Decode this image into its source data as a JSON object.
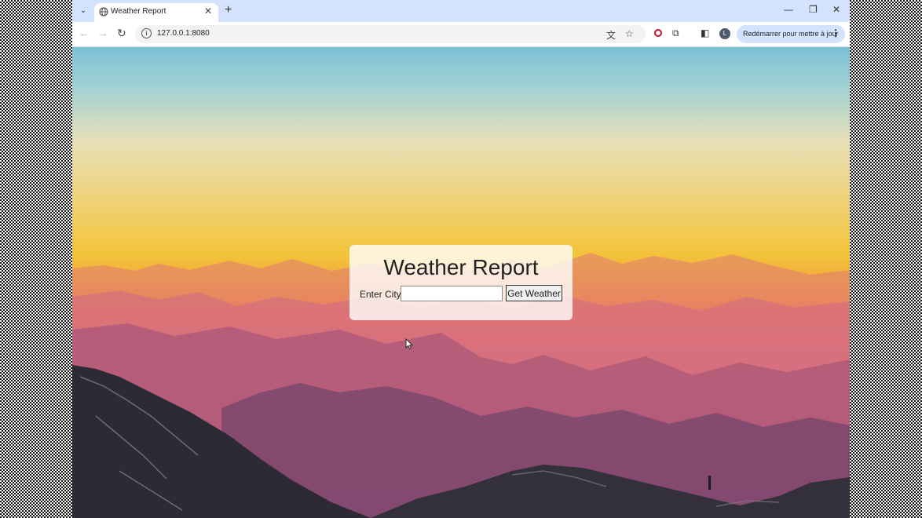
{
  "browser": {
    "tab": {
      "title": "Weather Report",
      "close_glyph": "✕"
    },
    "new_tab_glyph": "+",
    "tab_search_glyph": "⌄",
    "window_controls": {
      "minimize": "—",
      "restore": "❐",
      "close": "✕"
    },
    "nav": {
      "back": "←",
      "forward": "→",
      "reload": "↻"
    },
    "url": "127.0.0.1:8080",
    "site_info_glyph": "i",
    "translate_glyph": "文",
    "bookmark_glyph": "☆",
    "extensions_glyph": "⧉",
    "side_panel_glyph": "◧",
    "avatar_letter": "L",
    "update_button_label": "Redémarrer pour mettre à jour",
    "menu_glyph": "⋮"
  },
  "page": {
    "title": "Weather Report",
    "city_label": "Enter City:",
    "city_input_value": "",
    "submit_label": "Get Weather"
  }
}
